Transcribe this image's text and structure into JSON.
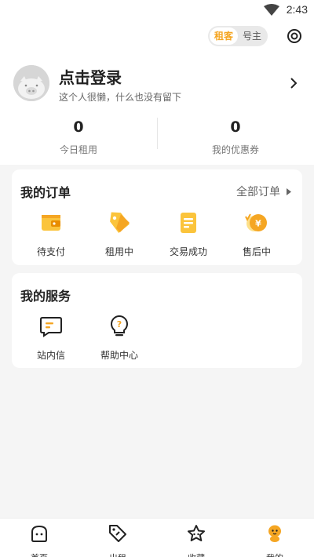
{
  "status_bar": {
    "time": "2:43"
  },
  "role_switch": {
    "tenant": "租客",
    "owner": "号主"
  },
  "profile": {
    "title": "点击登录",
    "subtitle": "这个人很懒，什么也没有留下"
  },
  "stats": [
    {
      "value": "0",
      "label": "今日租用"
    },
    {
      "value": "0",
      "label": "我的优惠券"
    }
  ],
  "orders": {
    "title": "我的订单",
    "all_label": "全部订单",
    "items": [
      {
        "label": "待支付",
        "icon": "wallet-icon"
      },
      {
        "label": "租用中",
        "icon": "tag-icon"
      },
      {
        "label": "交易成功",
        "icon": "document-icon"
      },
      {
        "label": "售后中",
        "icon": "refund-yen-icon"
      }
    ]
  },
  "services": {
    "title": "我的服务",
    "items": [
      {
        "label": "站内信",
        "icon": "message-icon"
      },
      {
        "label": "帮助中心",
        "icon": "help-bulb-icon"
      }
    ]
  },
  "tabbar": [
    {
      "label": "首页",
      "icon": "home-icon"
    },
    {
      "label": "出租",
      "icon": "tag-icon"
    },
    {
      "label": "收藏",
      "icon": "star-icon"
    },
    {
      "label": "我的",
      "icon": "mine-icon"
    }
  ],
  "colors": {
    "accent": "#f5a623",
    "background": "#f5f5f5"
  }
}
